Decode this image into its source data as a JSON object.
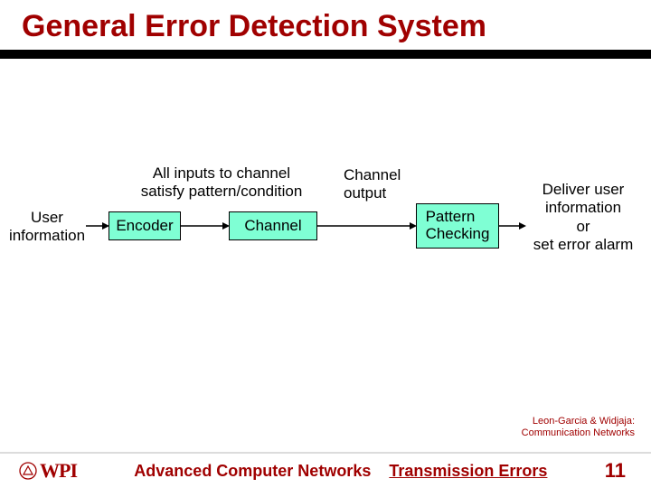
{
  "title": "General Error Detection System",
  "diagram": {
    "user_info_label": "User\ninformation",
    "encoder_box": "Encoder",
    "all_inputs_label": "All inputs to channel\nsatisfy pattern/condition",
    "channel_box": "Channel",
    "channel_output_label": "Channel\noutput",
    "pattern_box": "Pattern\nChecking",
    "deliver_label": "Deliver user\ninformation\nor\nset error alarm"
  },
  "attribution": "Leon-Garcia & Widjaja:\nCommunication Networks",
  "footer": {
    "course": "Advanced Computer Networks",
    "topic": "Transmission Errors",
    "page": "11",
    "logo_text": "WPI"
  }
}
